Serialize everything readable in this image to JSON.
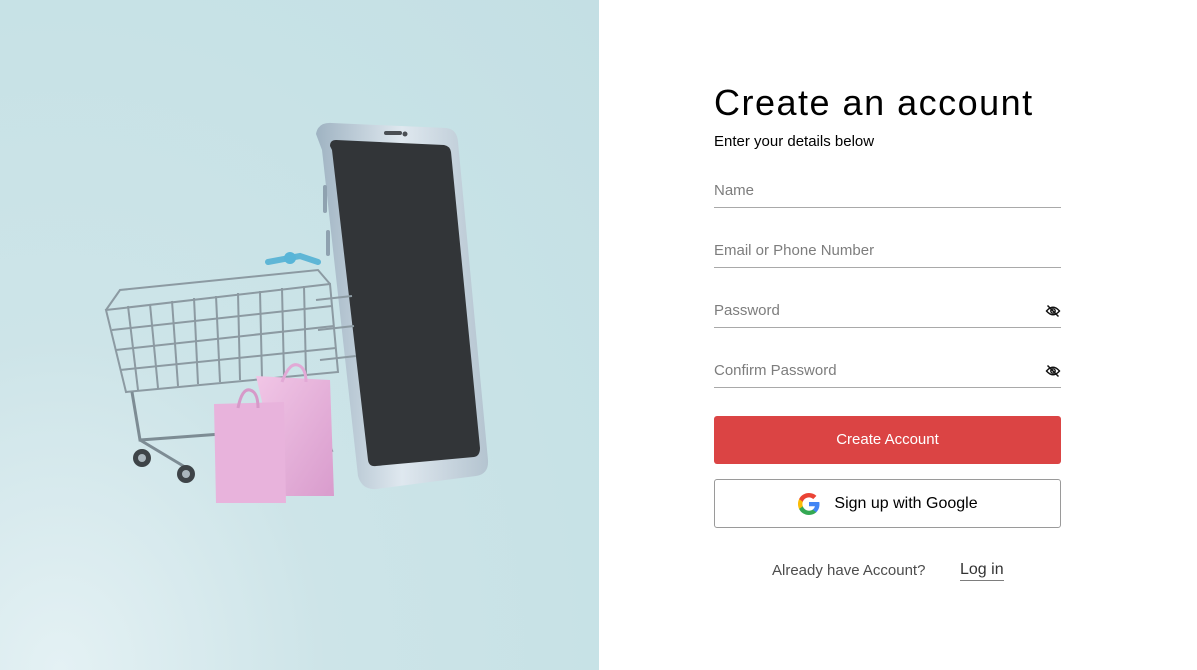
{
  "hero": {
    "image_name": "shopping-cart-phone-illustration",
    "bg_color": "#c7e2e6"
  },
  "signup": {
    "title": "Create an account",
    "subtitle": "Enter your details below",
    "name_placeholder": "Name",
    "email_placeholder": "Email or Phone Number",
    "password_placeholder": "Password",
    "confirm_password_placeholder": "Confirm Password",
    "password_toggle_icon": "eye-off-icon",
    "create_button_label": "Create Account",
    "google_button_label": "Sign up with Google",
    "google_icon": "google-icon",
    "accent_color": "#db4444"
  },
  "footer": {
    "question": "Already have Account?",
    "login_link": "Log in"
  }
}
